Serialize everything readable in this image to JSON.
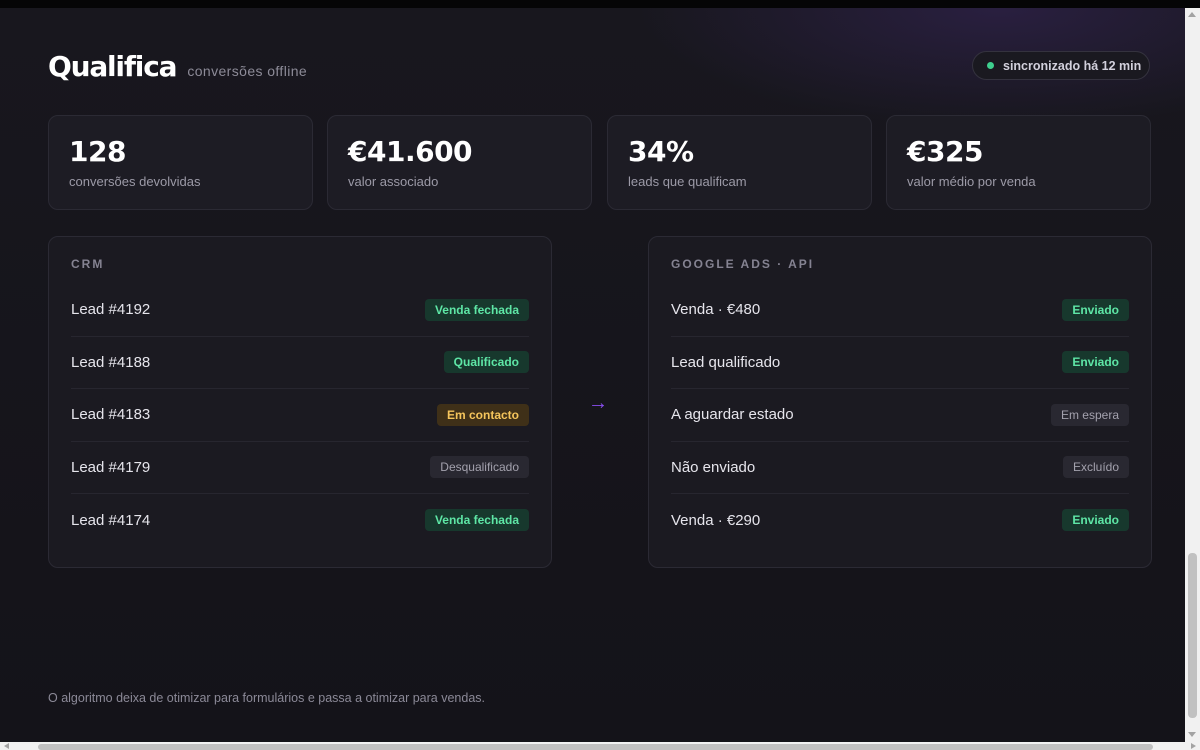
{
  "header": {
    "logo": "Qualifica",
    "subtitle": "conversões offline",
    "sync_status": "sincronizado há 12 min"
  },
  "stats": [
    {
      "value": "128",
      "label": "conversões devolvidas"
    },
    {
      "value": "€41.600",
      "label": "valor associado"
    },
    {
      "value": "34%",
      "label": "leads que qualificam"
    },
    {
      "value": "€325",
      "label": "valor médio por venda"
    }
  ],
  "crm": {
    "title": "CRM",
    "rows": [
      {
        "label": "Lead #4192",
        "status": "Venda fechada",
        "tone": "green"
      },
      {
        "label": "Lead #4188",
        "status": "Qualificado",
        "tone": "green"
      },
      {
        "label": "Lead #4183",
        "status": "Em contacto",
        "tone": "yellow"
      },
      {
        "label": "Lead #4179",
        "status": "Desqualificado",
        "tone": "gray"
      },
      {
        "label": "Lead #4174",
        "status": "Venda fechada",
        "tone": "green"
      }
    ]
  },
  "ads": {
    "title": "GOOGLE ADS · API",
    "rows": [
      {
        "label": "Venda · €480",
        "status": "Enviado",
        "tone": "green"
      },
      {
        "label": "Lead qualificado",
        "status": "Enviado",
        "tone": "green"
      },
      {
        "label": "A aguardar estado",
        "status": "Em espera",
        "tone": "gray"
      },
      {
        "label": "Não enviado",
        "status": "Excluído",
        "tone": "gray"
      },
      {
        "label": "Venda · €290",
        "status": "Enviado",
        "tone": "green"
      }
    ]
  },
  "flow_arrow": "→",
  "footer": "O algoritmo deixa de otimizar para formulários e passa a otimizar para vendas.",
  "colors": {
    "background": "#15141b",
    "card": "#1d1c24",
    "accent_green": "#3ecf8e",
    "accent_yellow": "#f5c55c",
    "arrow": "#8a4ef0"
  },
  "scroll": {
    "vertical_position": 1.0
  }
}
